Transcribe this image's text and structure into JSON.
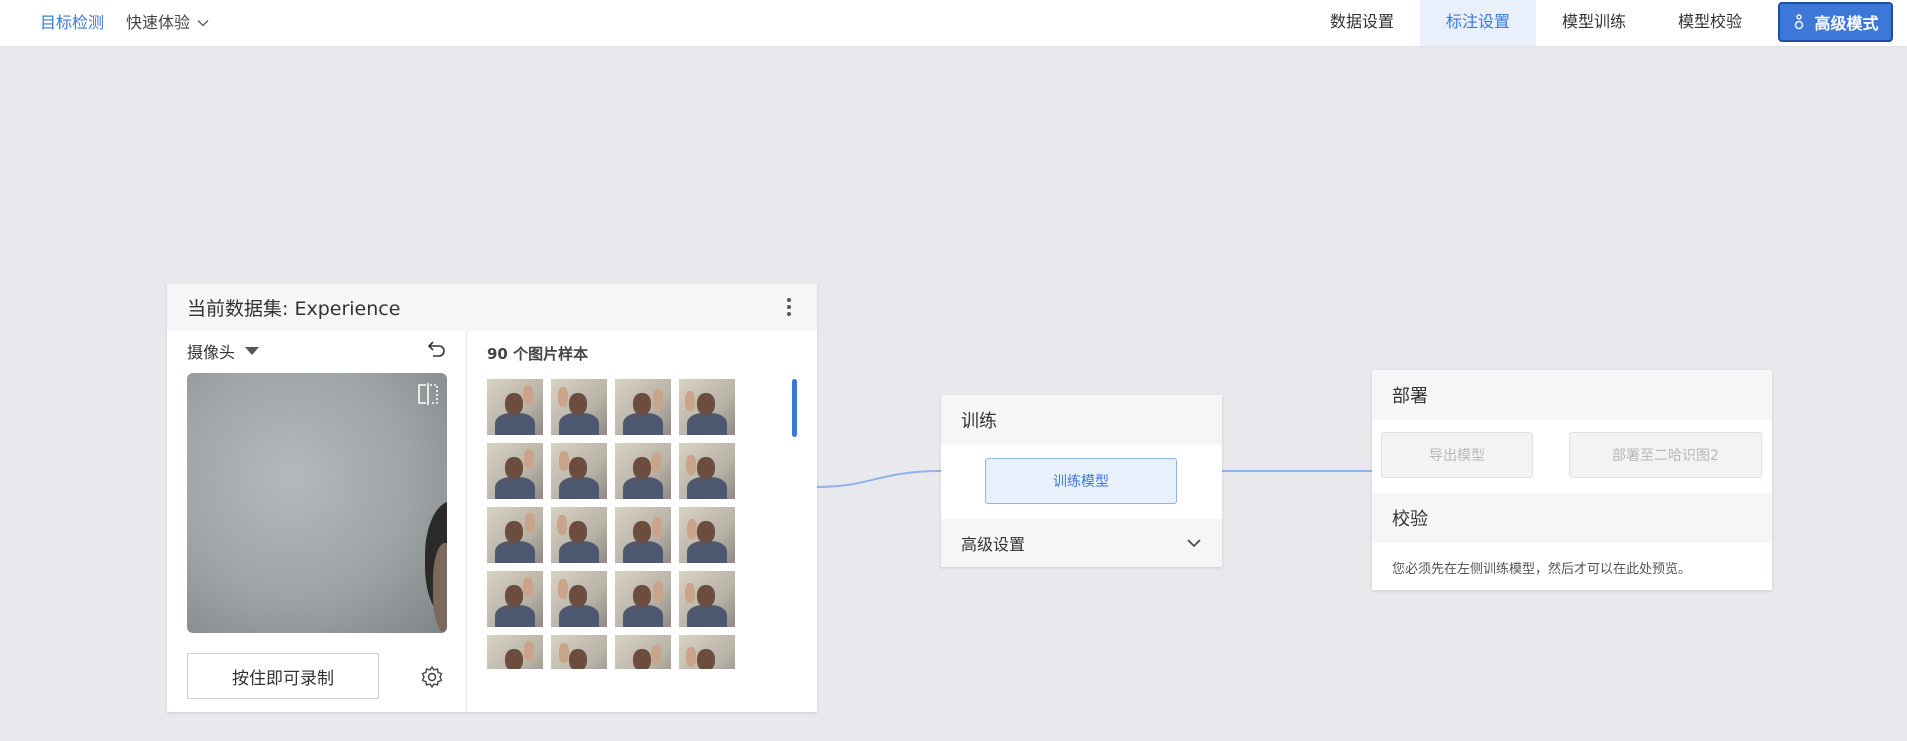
{
  "topbar": {
    "brand": "目标检测",
    "quick": "快速体验",
    "tabs": [
      {
        "label": "数据设置",
        "active": false
      },
      {
        "label": "标注设置",
        "active": true
      },
      {
        "label": "模型训练",
        "active": false
      },
      {
        "label": "模型校验",
        "active": false
      }
    ],
    "advanced_label": "高级模式",
    "advanced_icon": "person-icon"
  },
  "dataset": {
    "title": "当前数据集: Experience",
    "source": "摄像头",
    "record_label": "按住即可录制",
    "samples_title": "90 个图片样本",
    "sample_count_visible": 20
  },
  "training": {
    "title": "训练",
    "train_button": "训练模型",
    "advanced_settings": "高级设置"
  },
  "deploy": {
    "title": "部署",
    "export_button": "导出模型",
    "deploy_button": "部署至二哈识图2",
    "verify_title": "校验",
    "verify_message": "您必须先在左侧训练模型，然后才可以在此处预览。"
  },
  "colors": {
    "accent": "#3d78d8",
    "background": "#e8e9ed",
    "connector": "#8fb3ea"
  }
}
